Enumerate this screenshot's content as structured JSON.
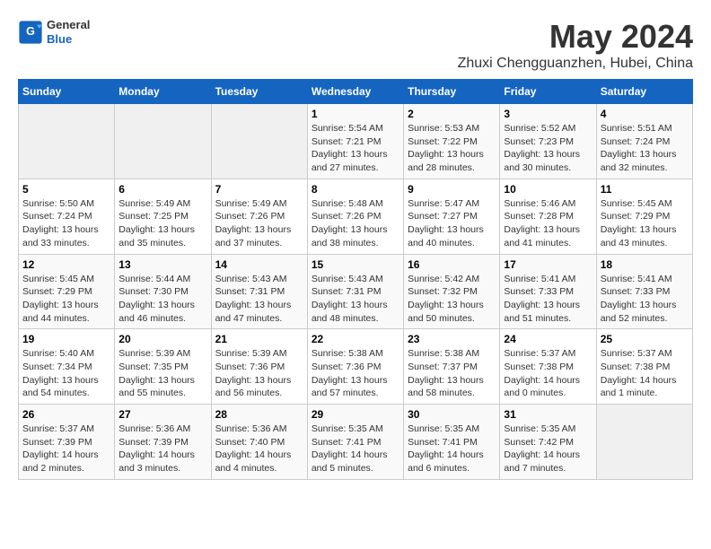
{
  "logo": {
    "line1": "General",
    "line2": "Blue"
  },
  "title": "May 2024",
  "subtitle": "Zhuxi Chengguanzhen, Hubei, China",
  "days_of_week": [
    "Sunday",
    "Monday",
    "Tuesday",
    "Wednesday",
    "Thursday",
    "Friday",
    "Saturday"
  ],
  "weeks": [
    [
      {
        "day": "",
        "empty": true
      },
      {
        "day": "",
        "empty": true
      },
      {
        "day": "",
        "empty": true
      },
      {
        "day": "1",
        "sunrise": "5:54 AM",
        "sunset": "7:21 PM",
        "daylight": "13 hours and 27 minutes."
      },
      {
        "day": "2",
        "sunrise": "5:53 AM",
        "sunset": "7:22 PM",
        "daylight": "13 hours and 28 minutes."
      },
      {
        "day": "3",
        "sunrise": "5:52 AM",
        "sunset": "7:23 PM",
        "daylight": "13 hours and 30 minutes."
      },
      {
        "day": "4",
        "sunrise": "5:51 AM",
        "sunset": "7:24 PM",
        "daylight": "13 hours and 32 minutes."
      }
    ],
    [
      {
        "day": "5",
        "sunrise": "5:50 AM",
        "sunset": "7:24 PM",
        "daylight": "13 hours and 33 minutes."
      },
      {
        "day": "6",
        "sunrise": "5:49 AM",
        "sunset": "7:25 PM",
        "daylight": "13 hours and 35 minutes."
      },
      {
        "day": "7",
        "sunrise": "5:49 AM",
        "sunset": "7:26 PM",
        "daylight": "13 hours and 37 minutes."
      },
      {
        "day": "8",
        "sunrise": "5:48 AM",
        "sunset": "7:26 PM",
        "daylight": "13 hours and 38 minutes."
      },
      {
        "day": "9",
        "sunrise": "5:47 AM",
        "sunset": "7:27 PM",
        "daylight": "13 hours and 40 minutes."
      },
      {
        "day": "10",
        "sunrise": "5:46 AM",
        "sunset": "7:28 PM",
        "daylight": "13 hours and 41 minutes."
      },
      {
        "day": "11",
        "sunrise": "5:45 AM",
        "sunset": "7:29 PM",
        "daylight": "13 hours and 43 minutes."
      }
    ],
    [
      {
        "day": "12",
        "sunrise": "5:45 AM",
        "sunset": "7:29 PM",
        "daylight": "13 hours and 44 minutes."
      },
      {
        "day": "13",
        "sunrise": "5:44 AM",
        "sunset": "7:30 PM",
        "daylight": "13 hours and 46 minutes."
      },
      {
        "day": "14",
        "sunrise": "5:43 AM",
        "sunset": "7:31 PM",
        "daylight": "13 hours and 47 minutes."
      },
      {
        "day": "15",
        "sunrise": "5:43 AM",
        "sunset": "7:31 PM",
        "daylight": "13 hours and 48 minutes."
      },
      {
        "day": "16",
        "sunrise": "5:42 AM",
        "sunset": "7:32 PM",
        "daylight": "13 hours and 50 minutes."
      },
      {
        "day": "17",
        "sunrise": "5:41 AM",
        "sunset": "7:33 PM",
        "daylight": "13 hours and 51 minutes."
      },
      {
        "day": "18",
        "sunrise": "5:41 AM",
        "sunset": "7:33 PM",
        "daylight": "13 hours and 52 minutes."
      }
    ],
    [
      {
        "day": "19",
        "sunrise": "5:40 AM",
        "sunset": "7:34 PM",
        "daylight": "13 hours and 54 minutes."
      },
      {
        "day": "20",
        "sunrise": "5:39 AM",
        "sunset": "7:35 PM",
        "daylight": "13 hours and 55 minutes."
      },
      {
        "day": "21",
        "sunrise": "5:39 AM",
        "sunset": "7:36 PM",
        "daylight": "13 hours and 56 minutes."
      },
      {
        "day": "22",
        "sunrise": "5:38 AM",
        "sunset": "7:36 PM",
        "daylight": "13 hours and 57 minutes."
      },
      {
        "day": "23",
        "sunrise": "5:38 AM",
        "sunset": "7:37 PM",
        "daylight": "13 hours and 58 minutes."
      },
      {
        "day": "24",
        "sunrise": "5:37 AM",
        "sunset": "7:38 PM",
        "daylight": "14 hours and 0 minutes."
      },
      {
        "day": "25",
        "sunrise": "5:37 AM",
        "sunset": "7:38 PM",
        "daylight": "14 hours and 1 minute."
      }
    ],
    [
      {
        "day": "26",
        "sunrise": "5:37 AM",
        "sunset": "7:39 PM",
        "daylight": "14 hours and 2 minutes."
      },
      {
        "day": "27",
        "sunrise": "5:36 AM",
        "sunset": "7:39 PM",
        "daylight": "14 hours and 3 minutes."
      },
      {
        "day": "28",
        "sunrise": "5:36 AM",
        "sunset": "7:40 PM",
        "daylight": "14 hours and 4 minutes."
      },
      {
        "day": "29",
        "sunrise": "5:35 AM",
        "sunset": "7:41 PM",
        "daylight": "14 hours and 5 minutes."
      },
      {
        "day": "30",
        "sunrise": "5:35 AM",
        "sunset": "7:41 PM",
        "daylight": "14 hours and 6 minutes."
      },
      {
        "day": "31",
        "sunrise": "5:35 AM",
        "sunset": "7:42 PM",
        "daylight": "14 hours and 7 minutes."
      },
      {
        "day": "",
        "empty": true
      }
    ]
  ],
  "labels": {
    "sunrise": "Sunrise:",
    "sunset": "Sunset:",
    "daylight": "Daylight:"
  }
}
